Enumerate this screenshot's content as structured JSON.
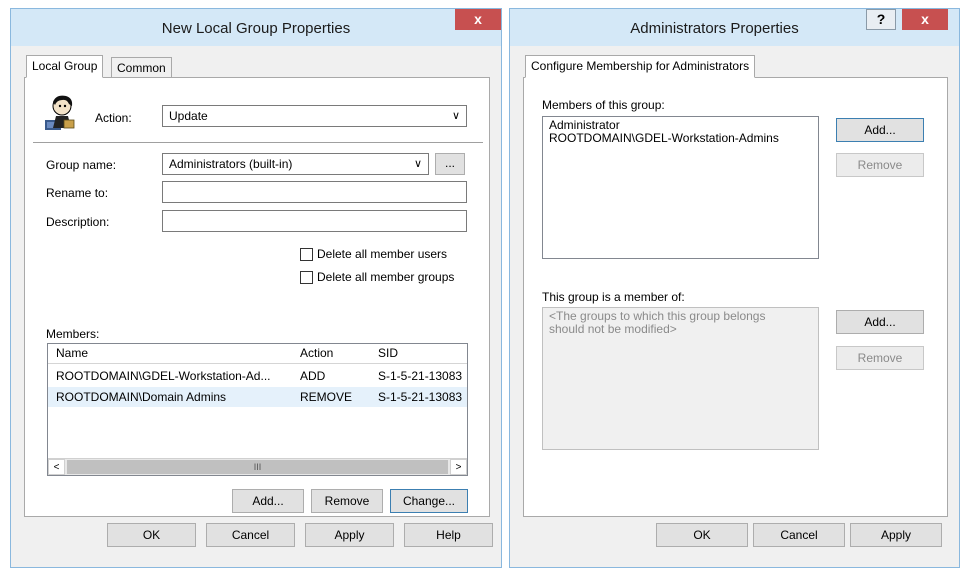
{
  "left_window": {
    "title": "New Local Group Properties",
    "close_glyph": "x",
    "tabs": [
      {
        "label": "Local Group"
      },
      {
        "label": "Common"
      }
    ],
    "action_label": "Action:",
    "action_value": "Update",
    "group_name_label": "Group name:",
    "group_name_value": "Administrators (built-in)",
    "browse_label": "...",
    "rename_label": "Rename to:",
    "description_label": "Description:",
    "delete_users_label": "Delete all member users",
    "delete_groups_label": "Delete all member groups",
    "members_label": "Members:",
    "columns": {
      "name": "Name",
      "action": "Action",
      "sid": "SID"
    },
    "rows": [
      {
        "name": "ROOTDOMAIN\\GDEL-Workstation-Ad...",
        "action": "ADD",
        "sid": "S-1-5-21-13083"
      },
      {
        "name": "ROOTDOMAIN\\Domain Admins",
        "action": "REMOVE",
        "sid": "S-1-5-21-13083"
      }
    ],
    "scroll_left": "<",
    "scroll_right": ">",
    "scroll_grip": "III",
    "buttons": {
      "add": "Add...",
      "remove": "Remove",
      "change": "Change..."
    },
    "footer": {
      "ok": "OK",
      "cancel": "Cancel",
      "apply": "Apply",
      "help": "Help"
    }
  },
  "right_window": {
    "title": "Administrators Properties",
    "help_glyph": "?",
    "close_glyph": "x",
    "tab": "Configure Membership for Administrators",
    "members_label": "Members of this group:",
    "members": [
      "Administrator",
      "ROOTDOMAIN\\GDEL-Workstation-Admins"
    ],
    "add1": "Add...",
    "remove1": "Remove",
    "member_of_label": "This group is a member of:",
    "member_of_text": "<The groups to which this group belongs should not be modified>",
    "add2": "Add...",
    "remove2": "Remove",
    "footer": {
      "ok": "OK",
      "cancel": "Cancel",
      "apply": "Apply"
    }
  },
  "colors": {
    "titlebar": "#d4e8f7",
    "close": "#c75050",
    "focus": "#3c7fb1"
  }
}
